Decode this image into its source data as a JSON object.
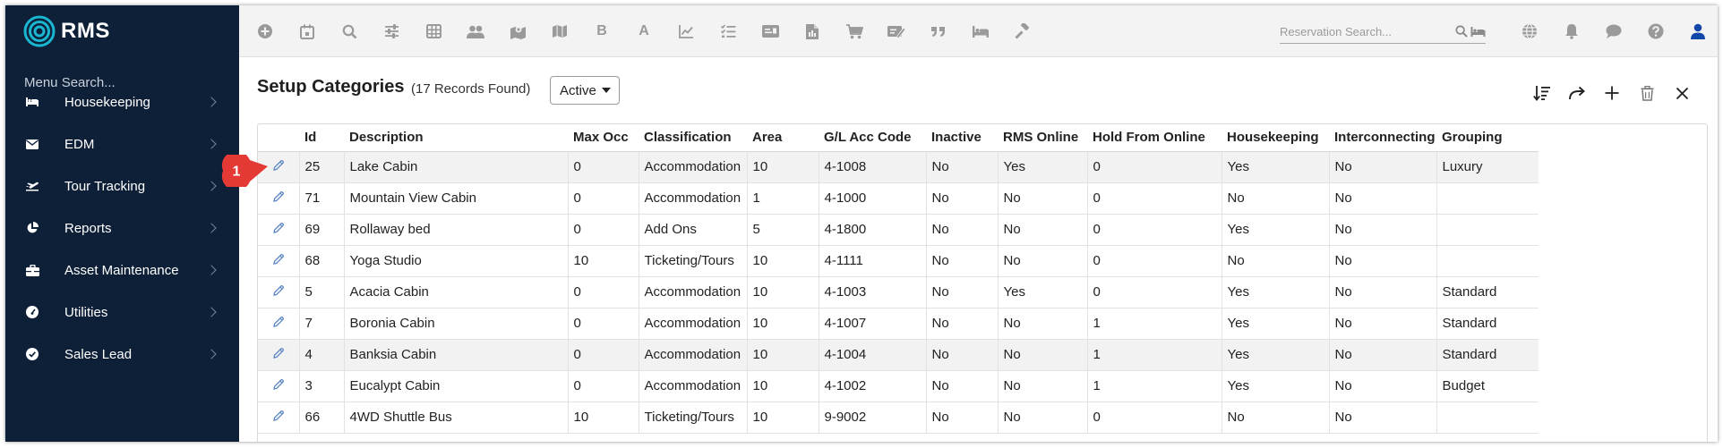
{
  "app": {
    "logo_text": "RMS"
  },
  "sidebar": {
    "search_placeholder": "Menu Search...",
    "items": [
      {
        "label": "Housekeeping",
        "icon": "bed-icon"
      },
      {
        "label": "EDM",
        "icon": "envelope-icon"
      },
      {
        "label": "Tour Tracking",
        "icon": "plane-icon"
      },
      {
        "label": "Reports",
        "icon": "pie-chart-icon"
      },
      {
        "label": "Asset Maintenance",
        "icon": "toolbox-icon"
      },
      {
        "label": "Utilities",
        "icon": "gauge-icon"
      },
      {
        "label": "Sales Lead",
        "icon": "check-circle-icon"
      }
    ]
  },
  "topbar": {
    "icons": [
      "add-circle-icon",
      "calendar-icon",
      "search-icon",
      "sliders-icon",
      "grid-icon",
      "users-icon",
      "map-pin-icon",
      "map-icon",
      "bold-b-icon",
      "font-a-icon",
      "line-chart-icon",
      "checklist-icon",
      "id-card-icon",
      "file-icon",
      "cart-icon",
      "ticket-icon",
      "quote-icon",
      "bed-icon",
      "gavel-icon"
    ],
    "b_label": "B",
    "a_label": "A",
    "reservation_search_placeholder": "Reservation Search...",
    "right_icons": [
      "globe-icon",
      "bell-icon",
      "chat-icon",
      "help-icon",
      "user-icon"
    ]
  },
  "header": {
    "title": "Setup Categories",
    "records": "(17 Records Found)",
    "status_value": "Active"
  },
  "table": {
    "columns": [
      "",
      "Id",
      "Description",
      "Max Occ",
      "Classification",
      "Area",
      "G/L Acc Code",
      "Inactive",
      "RMS Online",
      "Hold From Online",
      "Housekeeping",
      "Interconnecting",
      "Grouping"
    ],
    "rows": [
      [
        "25",
        "Lake Cabin",
        "0",
        "Accommodation",
        "10",
        "4-1008",
        "No",
        "Yes",
        "0",
        "Yes",
        "No",
        "Luxury"
      ],
      [
        "71",
        "Mountain View Cabin",
        "0",
        "Accommodation",
        "1",
        "4-1000",
        "No",
        "No",
        "0",
        "No",
        "No",
        ""
      ],
      [
        "69",
        "Rollaway bed",
        "0",
        "Add Ons",
        "5",
        "4-1800",
        "No",
        "No",
        "0",
        "Yes",
        "No",
        ""
      ],
      [
        "68",
        "Yoga Studio",
        "10",
        "Ticketing/Tours",
        "10",
        "4-1111",
        "No",
        "No",
        "0",
        "No",
        "No",
        ""
      ],
      [
        "5",
        "Acacia Cabin",
        "0",
        "Accommodation",
        "10",
        "4-1003",
        "No",
        "Yes",
        "0",
        "Yes",
        "No",
        "Standard"
      ],
      [
        "7",
        "Boronia Cabin",
        "0",
        "Accommodation",
        "10",
        "4-1007",
        "No",
        "No",
        "1",
        "Yes",
        "No",
        "Standard"
      ],
      [
        "4",
        "Banksia Cabin",
        "0",
        "Accommodation",
        "10",
        "4-1004",
        "No",
        "No",
        "1",
        "Yes",
        "No",
        "Standard"
      ],
      [
        "3",
        "Eucalypt Cabin",
        "0",
        "Accommodation",
        "10",
        "4-1002",
        "No",
        "No",
        "1",
        "Yes",
        "No",
        "Budget"
      ],
      [
        "66",
        "4WD Shuttle Bus",
        "10",
        "Ticketing/Tours",
        "10",
        "9-9002",
        "No",
        "No",
        "0",
        "No",
        "No",
        ""
      ]
    ]
  },
  "annotation": {
    "badge_number": "1"
  },
  "colors": {
    "sidebar_bg": "#0e1f38",
    "logo_accent": "#19b7d1",
    "badge": "#e53935"
  }
}
